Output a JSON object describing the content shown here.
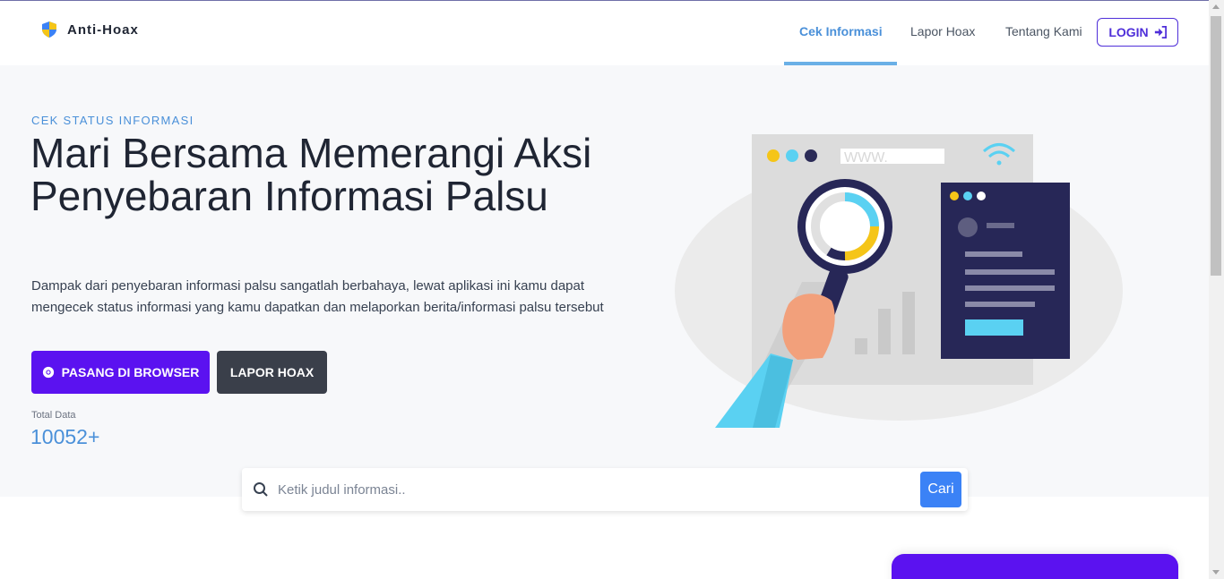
{
  "brand": {
    "name": "Anti-Hoax",
    "logo_icon": "shield-icon"
  },
  "nav": {
    "items": [
      {
        "label": "Cek Informasi",
        "active": true
      },
      {
        "label": "Lapor Hoax",
        "active": false
      },
      {
        "label": "Tentang Kami",
        "active": false
      }
    ],
    "login_label": "LOGIN",
    "login_icon": "sign-in-icon"
  },
  "hero": {
    "eyebrow": "CEK STATUS INFORMASI",
    "headline": "Mari Bersama Memerangi Aksi Penyebaran Informasi Palsu",
    "description": "Dampak dari penyebaran informasi palsu sangatlah berbahaya, lewat aplikasi ini kamu dapat mengecek status informasi yang kamu dapatkan dan melaporkan berita/informasi palsu tersebut",
    "primary_button": "PASANG DI BROWSER",
    "primary_button_icon": "chrome-icon",
    "secondary_button": "LAPOR HOAX",
    "total_label": "Total Data",
    "total_value": "10052+",
    "illustration_url_text": "WWW."
  },
  "search": {
    "placeholder": "Ketik judul informasi..",
    "value": "",
    "button_label": "Cari",
    "icon": "search-icon"
  },
  "colors": {
    "accent_purple": "#5b12f0",
    "accent_blue": "#4a90d9",
    "button_blue": "#3b82f6",
    "dark_button": "#3a3f4a",
    "hero_bg": "#f7f8fa"
  }
}
